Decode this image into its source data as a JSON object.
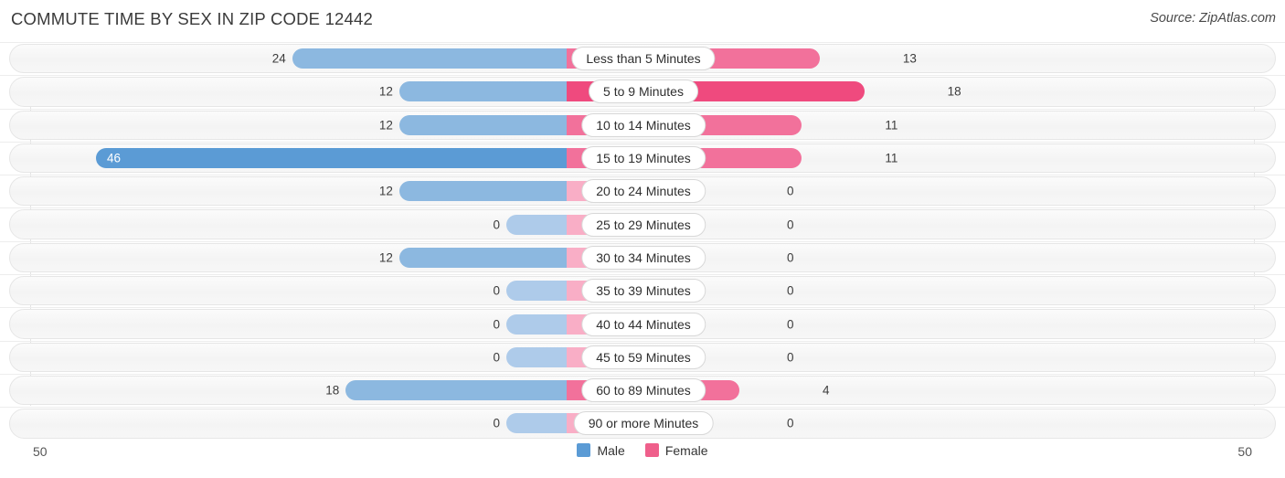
{
  "header": {
    "title": "COMMUTE TIME BY SEX IN ZIP CODE 12442",
    "source": "Source: ZipAtlas.com"
  },
  "axis": {
    "left_end_label": "50",
    "right_end_label": "50",
    "max": 50
  },
  "legend": {
    "items": [
      {
        "label": "Male",
        "color": "#5b9bd5"
      },
      {
        "label": "Female",
        "color": "#ef5f8b"
      }
    ]
  },
  "colors": {
    "male_strong": "#5b9bd5",
    "male_mid": "#8cb8e0",
    "male_light": "#aecbea",
    "female_strong": "#ef4a7e",
    "female_mid": "#f2719b",
    "female_light": "#f9aec6",
    "track": "#f5f5f5",
    "track_border": "#e6e6e6"
  },
  "chart_data": {
    "type": "bar",
    "subtype": "diverging-bidirectional",
    "title": "COMMUTE TIME BY SEX IN ZIP CODE 12442",
    "xlabel": "",
    "ylabel": "",
    "xlim": [
      50,
      50
    ],
    "grid": false,
    "legend_position": "bottom-center",
    "categories": [
      "Less than 5 Minutes",
      "5 to 9 Minutes",
      "10 to 14 Minutes",
      "15 to 19 Minutes",
      "20 to 24 Minutes",
      "25 to 29 Minutes",
      "30 to 34 Minutes",
      "35 to 39 Minutes",
      "40 to 44 Minutes",
      "45 to 59 Minutes",
      "60 to 89 Minutes",
      "90 or more Minutes"
    ],
    "series": [
      {
        "name": "Male",
        "color": "#5b9bd5",
        "direction": "left",
        "values": [
          24,
          12,
          12,
          46,
          12,
          0,
          12,
          0,
          0,
          0,
          18,
          0
        ]
      },
      {
        "name": "Female",
        "color": "#ef5f8b",
        "direction": "right",
        "values": [
          13,
          18,
          11,
          11,
          0,
          0,
          0,
          0,
          0,
          0,
          4,
          0
        ]
      }
    ]
  },
  "rows": [
    {
      "label": "Less than 5 Minutes",
      "male": {
        "value": 24,
        "text": "24",
        "color": "#8cb8e0",
        "inside": false
      },
      "female": {
        "value": 13,
        "text": "13",
        "color": "#f2719b",
        "inside": false
      }
    },
    {
      "label": "5 to 9 Minutes",
      "male": {
        "value": 12,
        "text": "12",
        "color": "#8cb8e0",
        "inside": false
      },
      "female": {
        "value": 18,
        "text": "18",
        "color": "#ef4a7e",
        "inside": false
      }
    },
    {
      "label": "10 to 14 Minutes",
      "male": {
        "value": 12,
        "text": "12",
        "color": "#8cb8e0",
        "inside": false
      },
      "female": {
        "value": 11,
        "text": "11",
        "color": "#f2719b",
        "inside": false
      }
    },
    {
      "label": "15 to 19 Minutes",
      "male": {
        "value": 46,
        "text": "46",
        "color": "#5b9bd5",
        "inside": true
      },
      "female": {
        "value": 11,
        "text": "11",
        "color": "#f2719b",
        "inside": false
      }
    },
    {
      "label": "20 to 24 Minutes",
      "male": {
        "value": 12,
        "text": "12",
        "color": "#8cb8e0",
        "inside": false
      },
      "female": {
        "value": 0,
        "text": "0",
        "color": "#f9aec6",
        "inside": false
      }
    },
    {
      "label": "25 to 29 Minutes",
      "male": {
        "value": 0,
        "text": "0",
        "color": "#aecbea",
        "inside": false
      },
      "female": {
        "value": 0,
        "text": "0",
        "color": "#f9aec6",
        "inside": false
      }
    },
    {
      "label": "30 to 34 Minutes",
      "male": {
        "value": 12,
        "text": "12",
        "color": "#8cb8e0",
        "inside": false
      },
      "female": {
        "value": 0,
        "text": "0",
        "color": "#f9aec6",
        "inside": false
      }
    },
    {
      "label": "35 to 39 Minutes",
      "male": {
        "value": 0,
        "text": "0",
        "color": "#aecbea",
        "inside": false
      },
      "female": {
        "value": 0,
        "text": "0",
        "color": "#f9aec6",
        "inside": false
      }
    },
    {
      "label": "40 to 44 Minutes",
      "male": {
        "value": 0,
        "text": "0",
        "color": "#aecbea",
        "inside": false
      },
      "female": {
        "value": 0,
        "text": "0",
        "color": "#f9aec6",
        "inside": false
      }
    },
    {
      "label": "45 to 59 Minutes",
      "male": {
        "value": 0,
        "text": "0",
        "color": "#aecbea",
        "inside": false
      },
      "female": {
        "value": 0,
        "text": "0",
        "color": "#f9aec6",
        "inside": false
      }
    },
    {
      "label": "60 to 89 Minutes",
      "male": {
        "value": 18,
        "text": "18",
        "color": "#8cb8e0",
        "inside": false
      },
      "female": {
        "value": 4,
        "text": "4",
        "color": "#f2719b",
        "inside": false
      }
    },
    {
      "label": "90 or more Minutes",
      "male": {
        "value": 0,
        "text": "0",
        "color": "#aecbea",
        "inside": false
      },
      "female": {
        "value": 0,
        "text": "0",
        "color": "#f9aec6",
        "inside": false
      }
    }
  ]
}
